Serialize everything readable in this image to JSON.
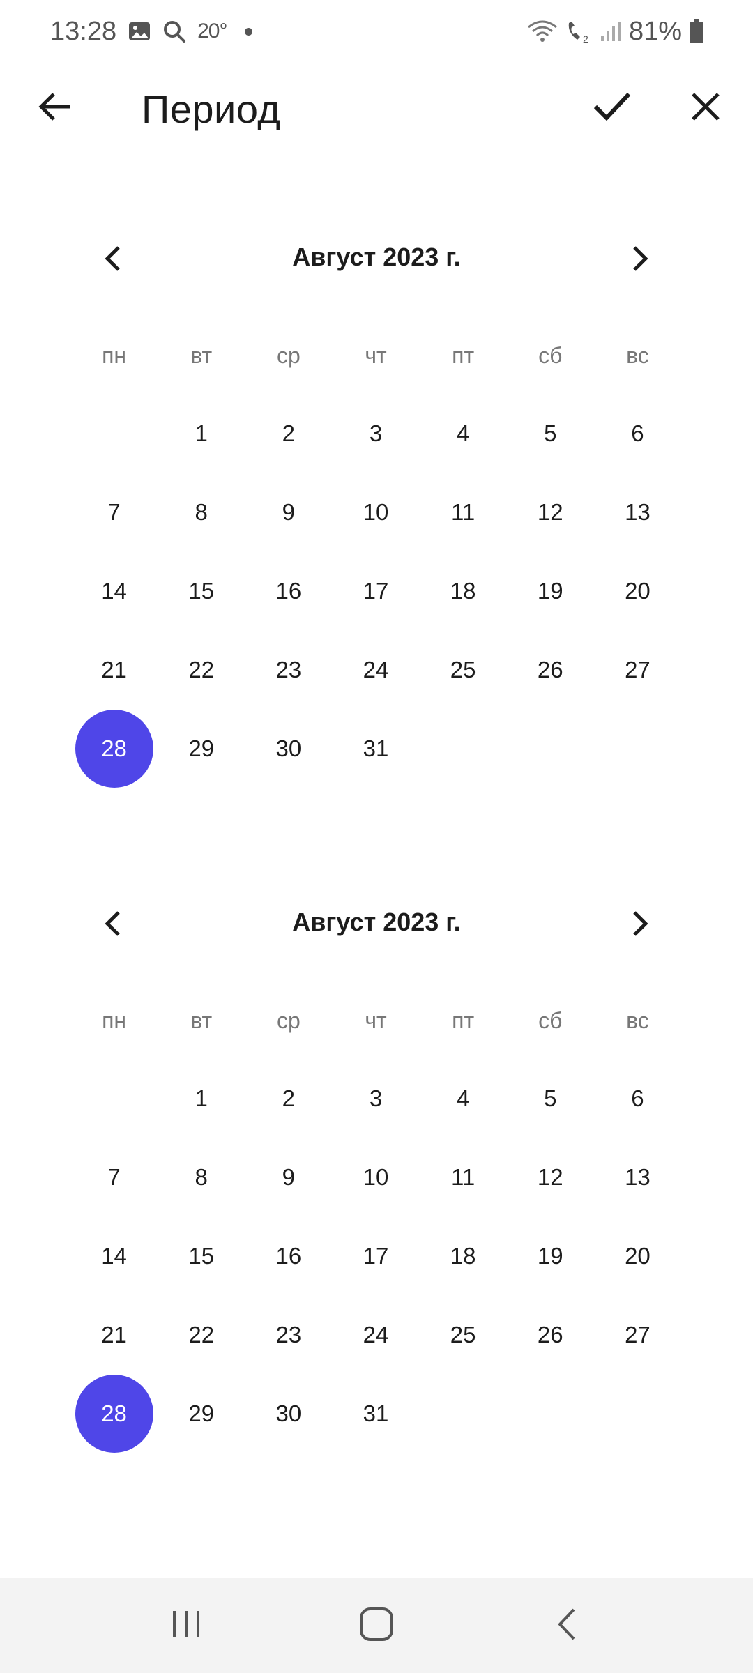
{
  "status_bar": {
    "time": "13:28",
    "temperature": "20°",
    "battery": "81%",
    "icons": [
      "gallery-icon",
      "search-icon",
      "wifi-icon",
      "wifi-calling-icon",
      "signal-icon",
      "battery-icon"
    ]
  },
  "app_bar": {
    "title": "Период",
    "icons": {
      "back": "arrow-left-icon",
      "confirm": "check-icon",
      "close": "close-icon"
    }
  },
  "calendars": [
    {
      "month_title": "Август 2023 г.",
      "weekdays": [
        "пн",
        "вт",
        "ср",
        "чт",
        "пт",
        "сб",
        "вс"
      ],
      "leading_blanks": 1,
      "days": [
        "1",
        "2",
        "3",
        "4",
        "5",
        "6",
        "7",
        "8",
        "9",
        "10",
        "11",
        "12",
        "13",
        "14",
        "15",
        "16",
        "17",
        "18",
        "19",
        "20",
        "21",
        "22",
        "23",
        "24",
        "25",
        "26",
        "27",
        "28",
        "29",
        "30",
        "31"
      ],
      "selected_day": "28"
    },
    {
      "month_title": "Август 2023 г.",
      "weekdays": [
        "пн",
        "вт",
        "ср",
        "чт",
        "пт",
        "сб",
        "вс"
      ],
      "leading_blanks": 1,
      "days": [
        "1",
        "2",
        "3",
        "4",
        "5",
        "6",
        "7",
        "8",
        "9",
        "10",
        "11",
        "12",
        "13",
        "14",
        "15",
        "16",
        "17",
        "18",
        "19",
        "20",
        "21",
        "22",
        "23",
        "24",
        "25",
        "26",
        "27",
        "28",
        "29",
        "30",
        "31"
      ],
      "selected_day": "28"
    }
  ],
  "colors": {
    "accent": "#4f46e8",
    "text": "#1c1c1c",
    "weekday_text": "#777777",
    "nav_bar_bg": "#f3f3f3"
  },
  "nav_bar": {
    "icons": [
      "recent-apps-icon",
      "home-icon",
      "back-icon"
    ]
  }
}
